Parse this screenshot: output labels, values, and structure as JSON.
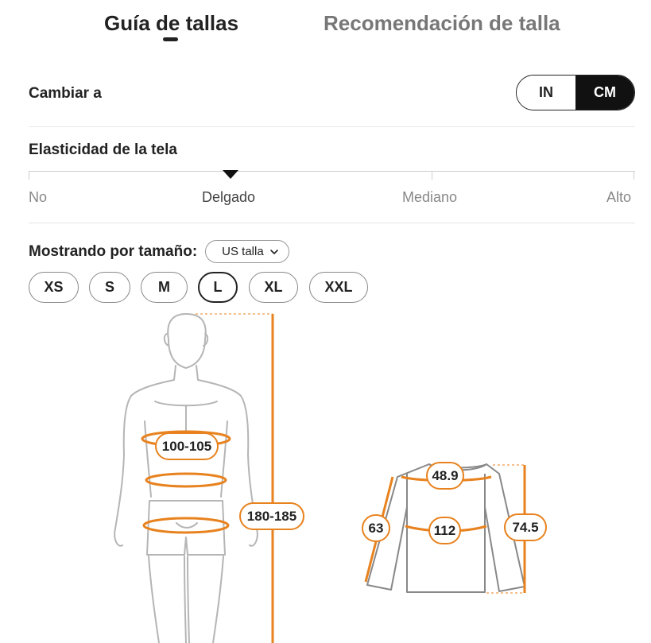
{
  "tabs": [
    {
      "label": "Guía de tallas",
      "active": true
    },
    {
      "label": "Recomendación de talla",
      "active": false
    }
  ],
  "unit_switch": {
    "label": "Cambiar a",
    "options": [
      "IN",
      "CM"
    ],
    "selected": "CM"
  },
  "fabric_stretch": {
    "title": "Elasticidad de la tela",
    "levels": [
      "No",
      "Delgado",
      "Mediano",
      "Alto"
    ],
    "selected": "Delgado"
  },
  "size_display": {
    "label": "Mostrando por tamaño:",
    "system": "US talla",
    "sizes": [
      "XS",
      "S",
      "M",
      "L",
      "XL",
      "XXL"
    ],
    "selected": "L"
  },
  "body_measurements": {
    "chest": "100-105",
    "height": "180-185"
  },
  "garment_measurements": {
    "shoulder": "48.9",
    "sleeve": "63",
    "bust": "112",
    "length": "74.5"
  },
  "colors": {
    "accent": "#e8821e",
    "selected_toggle": "#111111",
    "figure_line": "#b5b5b5"
  }
}
